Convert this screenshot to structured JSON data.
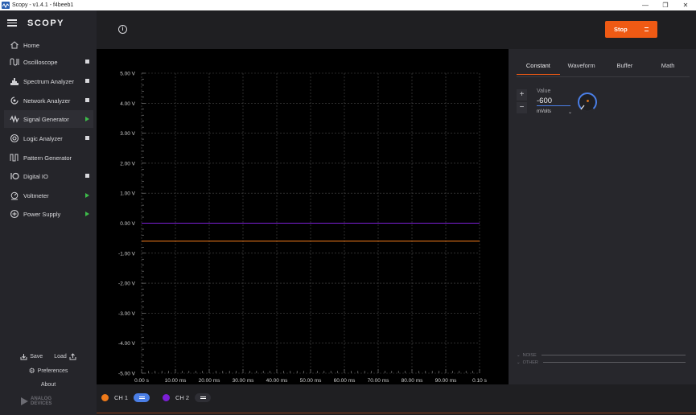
{
  "window": {
    "title": "Scopy - v1.4.1 - f4beeb1",
    "min_glyph": "—",
    "max_glyph": "❐",
    "close_glyph": "✕"
  },
  "brand": "SCOPY",
  "colors": {
    "accent": "#ef5a14",
    "ch1": "#ef7a1a",
    "ch2": "#7b1fd6",
    "active_state": "#3dbb4a",
    "selection_blue": "#4a7ee6"
  },
  "sidebar": {
    "home": {
      "label": "Home",
      "icon": "home-icon"
    },
    "items": [
      {
        "label": "Oscilloscope",
        "icon": "oscilloscope-icon",
        "state": "stopped"
      },
      {
        "label": "Spectrum Analyzer",
        "icon": "spectrum-icon",
        "state": "stopped"
      },
      {
        "label": "Network Analyzer",
        "icon": "network-icon",
        "state": "stopped"
      },
      {
        "label": "Signal Generator",
        "icon": "signal-generator-icon",
        "state": "running"
      },
      {
        "label": "Logic Analyzer",
        "icon": "logic-icon",
        "state": "stopped"
      },
      {
        "label": "Pattern Generator",
        "icon": "pattern-icon",
        "state": "none"
      },
      {
        "label": "Digital IO",
        "icon": "digital-io-icon",
        "state": "stopped"
      },
      {
        "label": "Voltmeter",
        "icon": "voltmeter-icon",
        "state": "running"
      },
      {
        "label": "Power Supply",
        "icon": "power-supply-icon",
        "state": "running"
      }
    ],
    "save_label": "Save",
    "load_label": "Load",
    "preferences_label": "Preferences",
    "about_label": "About",
    "vendor_logo_line1": "ANALOG",
    "vendor_logo_line2": "DEVICES"
  },
  "toolbar": {
    "info_glyph": "i",
    "stop_label": "Stop"
  },
  "plot": {
    "y_ticks": [
      "5.00 V",
      "4.00 V",
      "3.00 V",
      "2.00 V",
      "1.00 V",
      "0.00 V",
      "-1.00 V",
      "-2.00 V",
      "-3.00 V",
      "-4.00 V",
      "-5.00 V"
    ],
    "x_ticks": [
      "0.00 s",
      "10.00 ms",
      "20.00 ms",
      "30.00 ms",
      "40.00 ms",
      "50.00 ms",
      "60.00 ms",
      "70.00 ms",
      "80.00 ms",
      "90.00 ms",
      "0.10 s"
    ],
    "ylim": [
      -5,
      5
    ],
    "xlim": [
      0,
      0.1
    ],
    "traces": [
      {
        "channel": "CH 1",
        "value_v": -0.6
      },
      {
        "channel": "CH 2",
        "value_v": 0.0
      }
    ]
  },
  "right_panel": {
    "tabs": [
      "Constant",
      "Waveform",
      "Buffer",
      "Math"
    ],
    "active_tab": "Constant",
    "plus_glyph": "+",
    "minus_glyph": "−",
    "value_label": "Value",
    "value": "-600",
    "unit": "mVolts",
    "unit_caret": "⌄",
    "noise_label": "NOISE",
    "other_label": "OTHER",
    "caret_glyph": "⌄"
  },
  "channels": [
    {
      "label": "CH 1",
      "enabled": true
    },
    {
      "label": "CH 2",
      "enabled": false
    }
  ]
}
